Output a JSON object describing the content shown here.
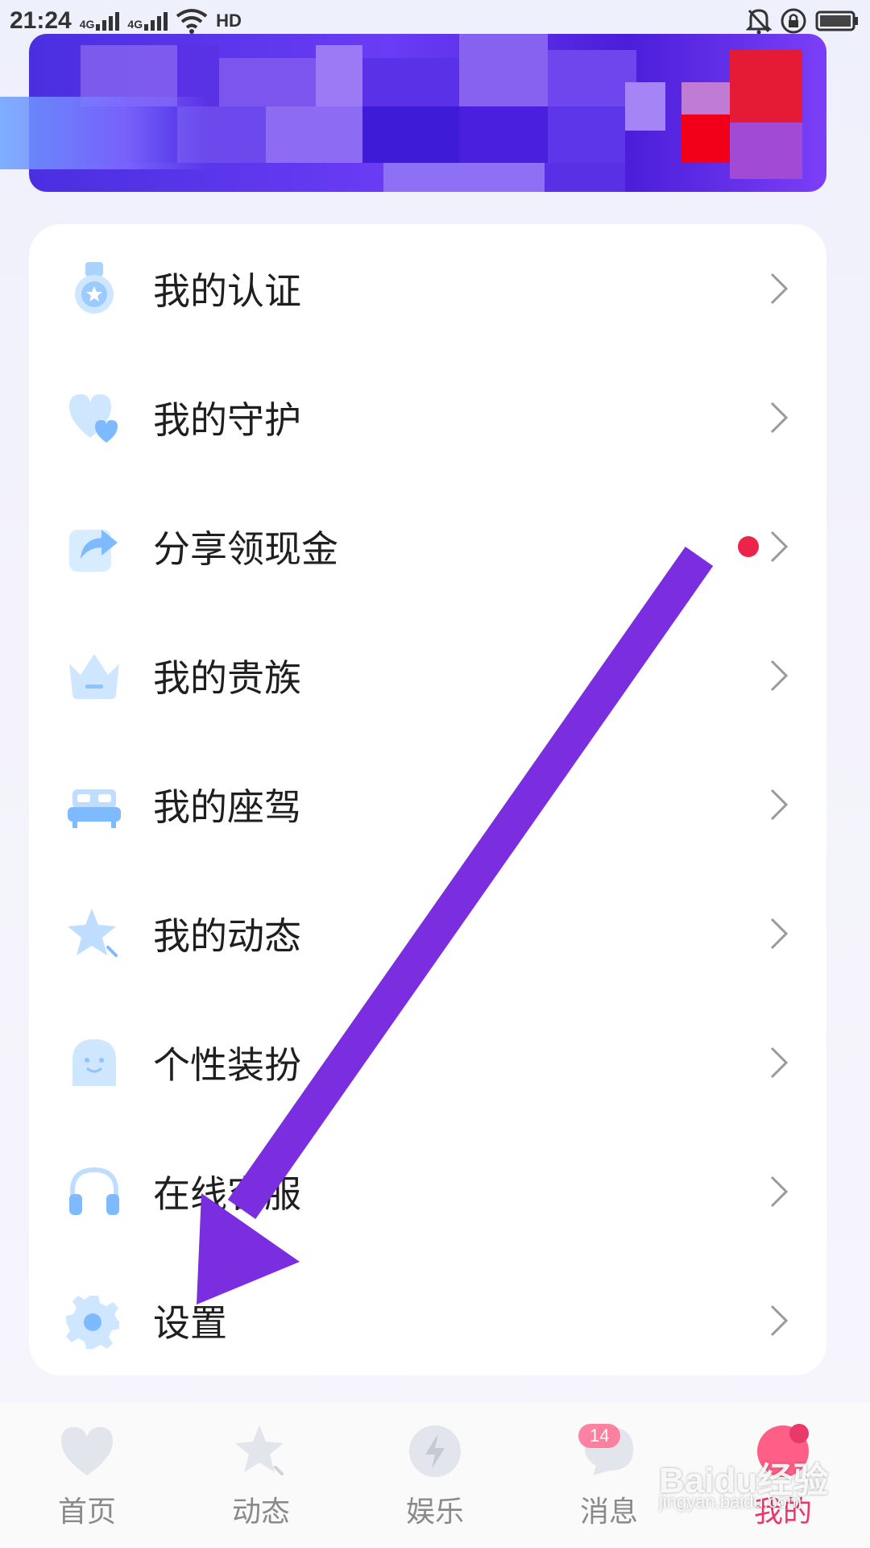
{
  "status_bar": {
    "time": "21:24",
    "signal1_label": "4G",
    "signal2_label": "4G",
    "hd_label": "HD"
  },
  "menu": {
    "items": [
      {
        "label": "我的认证",
        "icon": "certification-icon"
      },
      {
        "label": "我的守护",
        "icon": "heart-icon"
      },
      {
        "label": "分享领现金",
        "icon": "share-icon",
        "has_red_dot": true
      },
      {
        "label": "我的贵族",
        "icon": "crown-icon"
      },
      {
        "label": "我的座驾",
        "icon": "car-icon"
      },
      {
        "label": "我的动态",
        "icon": "star-icon"
      },
      {
        "label": "个性装扮",
        "icon": "ghost-icon"
      },
      {
        "label": "在线客服",
        "icon": "headphones-icon"
      },
      {
        "label": "设置",
        "icon": "gear-icon"
      }
    ]
  },
  "bottom_nav": {
    "tabs": [
      {
        "label": "首页",
        "icon": "heart-icon"
      },
      {
        "label": "动态",
        "icon": "star-icon"
      },
      {
        "label": "娱乐",
        "icon": "lightning-icon"
      },
      {
        "label": "消息",
        "icon": "message-icon",
        "badge": "14"
      },
      {
        "label": "我的",
        "icon": "profile-icon",
        "active": true
      }
    ]
  },
  "colors": {
    "accent_active": "#e8396a",
    "icon_blue": "#8fc8ff",
    "arrow_purple": "#7b2ee0",
    "red_dot": "#ec2449"
  },
  "watermark": {
    "brand": "Baidu经验",
    "url": "jingyan.baidu.com"
  }
}
